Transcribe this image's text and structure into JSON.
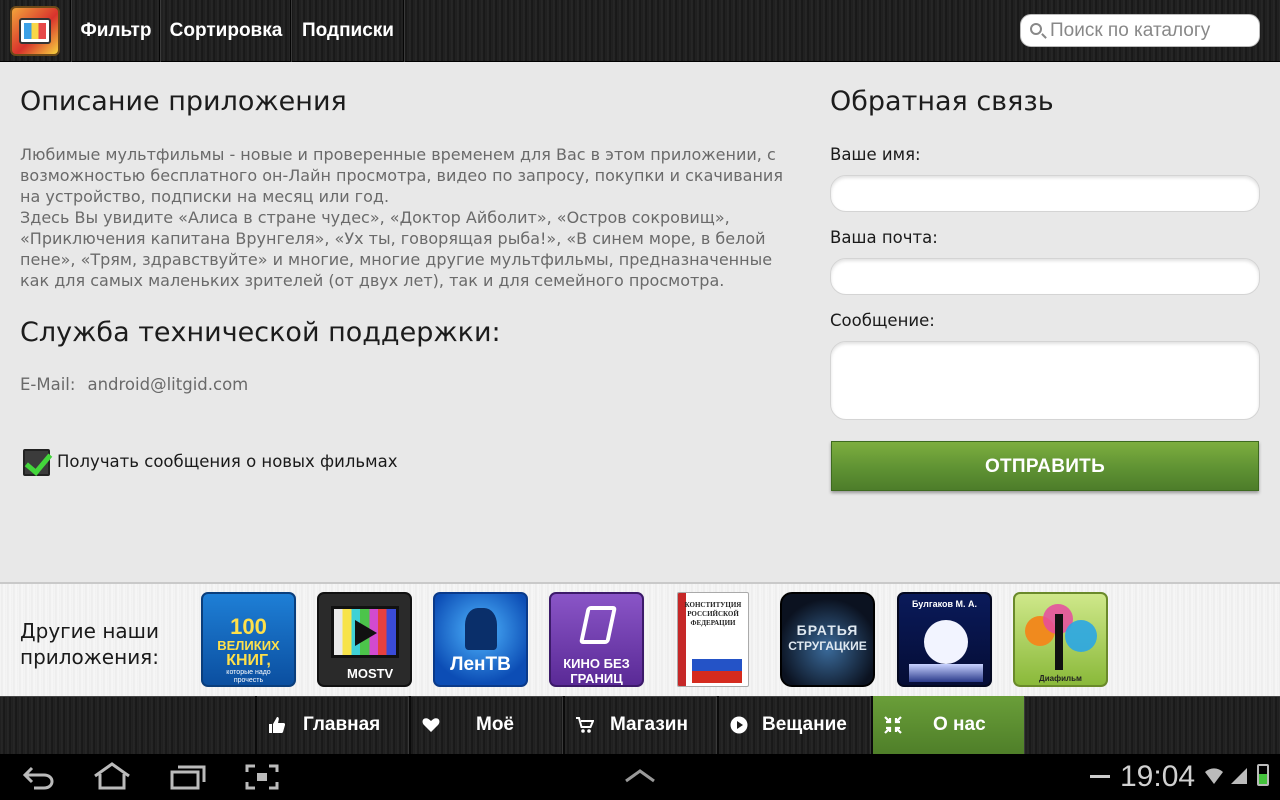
{
  "topbar": {
    "menu": [
      {
        "label": "Фильтр"
      },
      {
        "label": "Сортировка"
      },
      {
        "label": "Подписки"
      }
    ],
    "search_placeholder": "Поиск по каталогу"
  },
  "description": {
    "title": "Описание приложения",
    "paragraph1": "Любимые мультфильмы - новые и проверенные временем для Вас в этом приложении, с возможностью бесплатного он-Лайн просмотра, видео по запросу, покупки и скачивания на устройство, подписки на месяц или год.",
    "paragraph2": "Здесь Вы увидите «Алиса в стране чудес», «Доктор Айболит», «Остров сокровищ», «Приключения капитана Врунгеля», «Ух ты, говорящая рыба!», «В синем море, в белой пене», «Трям, здравствуйте» и многие, многие другие мультфильмы, предназначенные как для самых маленьких зрителей (от двух лет), так и для семейного просмотра."
  },
  "support": {
    "title": "Служба технической поддержки:",
    "email_label": "E-Mail:",
    "email_value": "android@litgid.com"
  },
  "subscribe": {
    "label": "Получать сообщения о новых фильмах",
    "checked": true
  },
  "feedback": {
    "title": "Обратная связь",
    "name_label": "Ваше имя:",
    "email_label": "Ваша почта:",
    "message_label": "Сообщение:",
    "submit_label": "ОТПРАВИТЬ"
  },
  "other_apps": {
    "label": "Другие наши приложения:",
    "apps": [
      {
        "name": "100 великих книг",
        "line1": "100",
        "line2": "ВЕЛИКИХ",
        "line3": "КНИГ,",
        "line4": "которые надо",
        "line5": "прочесть"
      },
      {
        "name": "MosTV",
        "line1": "MOSTV"
      },
      {
        "name": "ЛенТВ",
        "line1": "ЛенТВ"
      },
      {
        "name": "Кино без границ",
        "line1": "КИНО БЕЗ",
        "line2": "ГРАНИЦ"
      },
      {
        "name": "Конституция РФ",
        "line1": "КОНСТИТУЦИЯ",
        "line2": "РОССИЙСКОЙ",
        "line3": "ФЕДЕРАЦИИ"
      },
      {
        "name": "Братья Стругацкие",
        "line1": "БРАТЬЯ",
        "line2": "СТРУГАЦКИЕ"
      },
      {
        "name": "Булгаков М. А.",
        "line1": "Булгаков М. А."
      },
      {
        "name": "Диафильм",
        "line1": "Диафильм"
      }
    ]
  },
  "bottom_nav": {
    "items": [
      {
        "label": "Главная",
        "icon": "thumbs-up-icon"
      },
      {
        "label": "Моё",
        "icon": "heart-icon"
      },
      {
        "label": "Магазин",
        "icon": "cart-icon"
      },
      {
        "label": "Вещание",
        "icon": "play-icon"
      },
      {
        "label": "О нас",
        "icon": "collapse-icon",
        "active": true
      }
    ]
  },
  "system_bar": {
    "time": "19:04"
  },
  "colors": {
    "accent_green": "#5f9233",
    "checkbox_green": "#43d63b",
    "background": "#e8e8e8"
  }
}
